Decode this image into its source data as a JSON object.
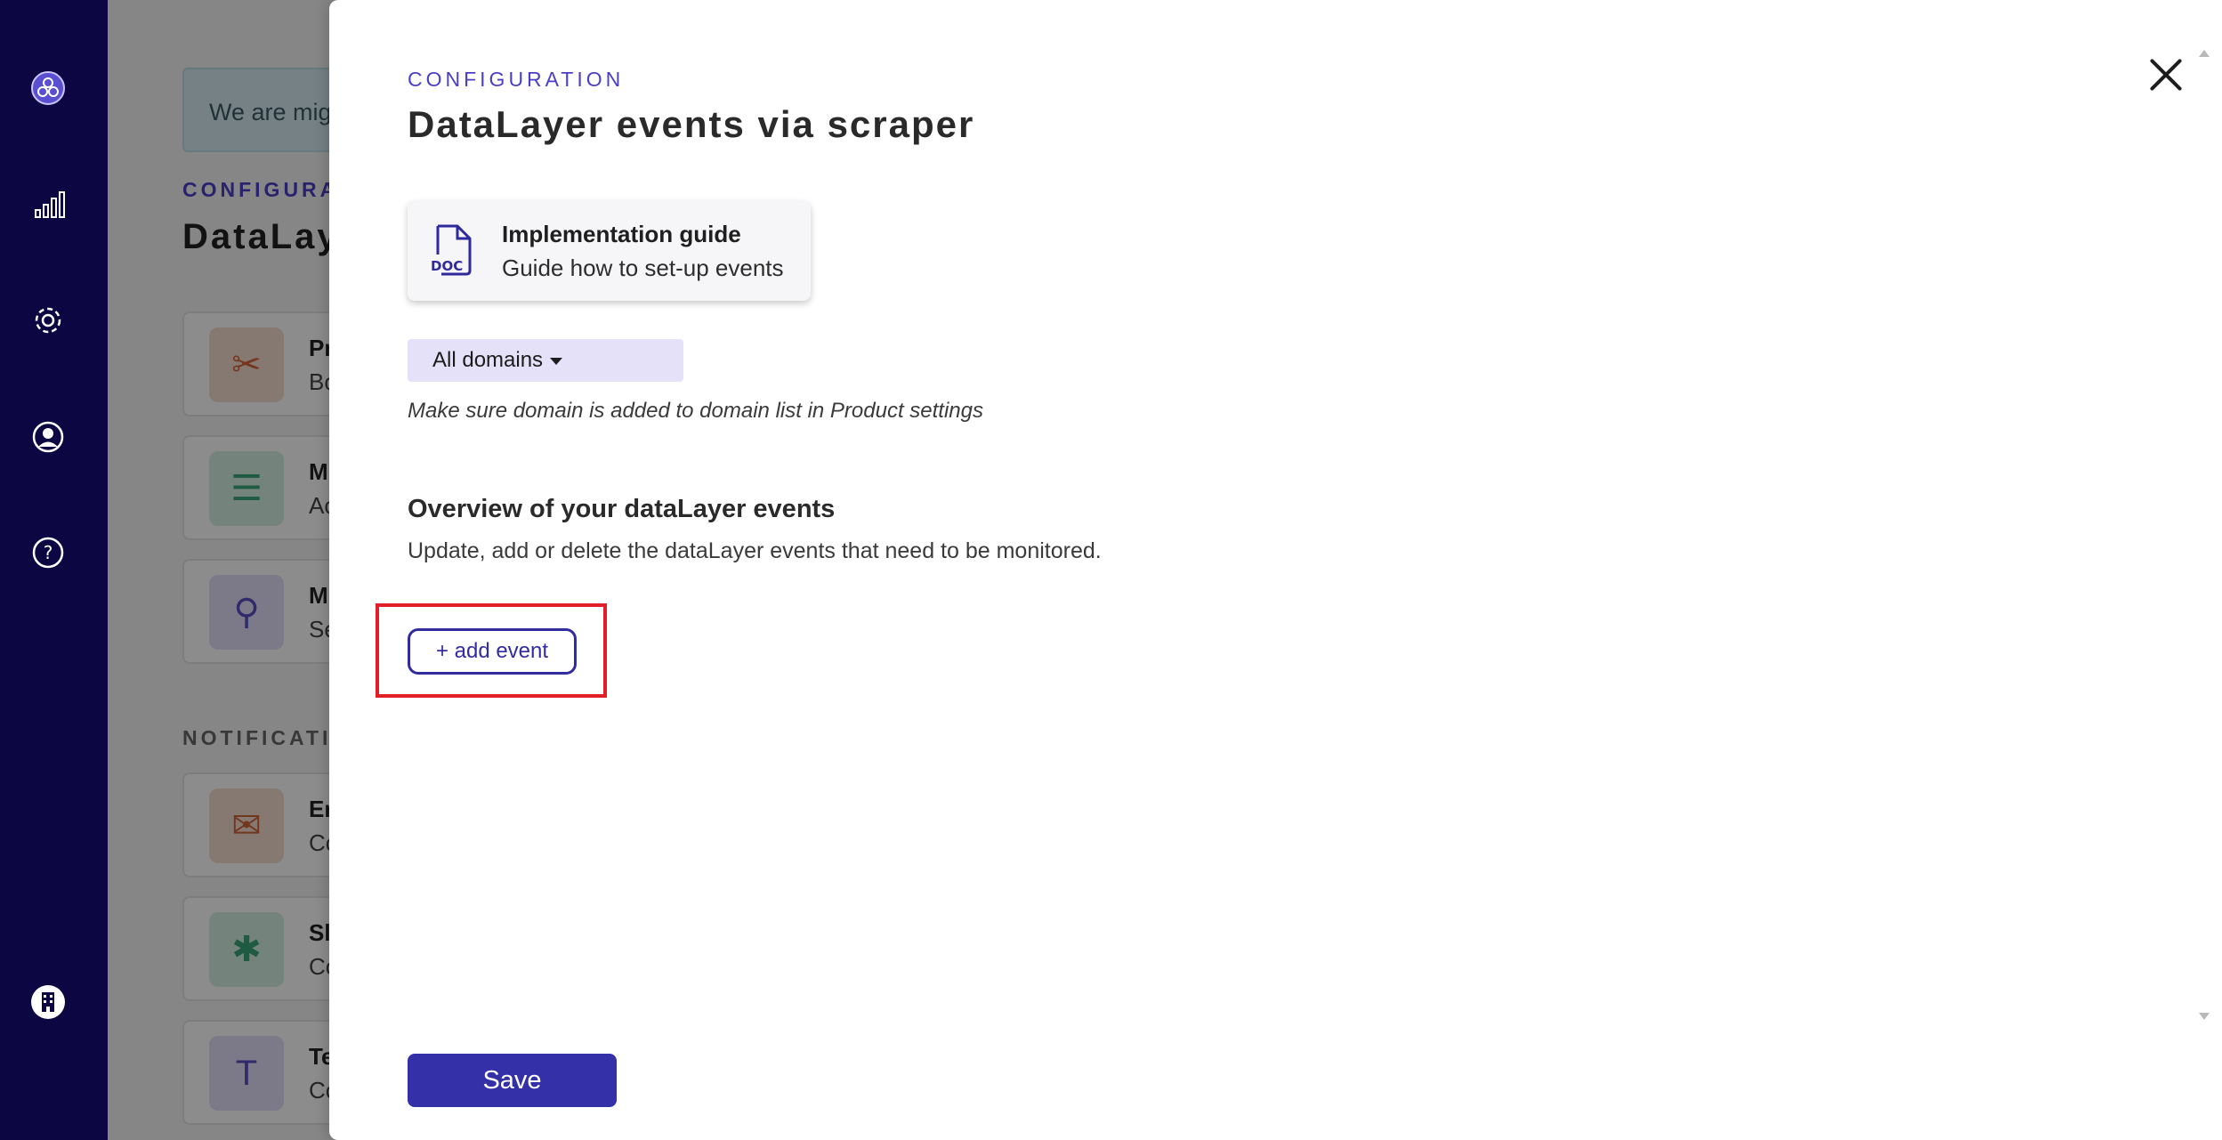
{
  "background": {
    "banner_text": "We are mig",
    "overline": "CONFIGURAT",
    "title": "DataLay",
    "cards": [
      {
        "title": "Pr",
        "subtitle": "Bo",
        "icon": "tools-icon",
        "color": "#e8a07a"
      },
      {
        "title": "M",
        "subtitle": "Ac",
        "icon": "list-icon",
        "color": "#8fd0b5"
      },
      {
        "title": "M",
        "subtitle": "Se",
        "icon": "binoculars-icon",
        "color": "#9a90e0"
      }
    ],
    "notifications_label": "NOTIFICATION",
    "notification_cards": [
      {
        "title": "Er",
        "subtitle": "Co",
        "icon": "mail-icon",
        "color": "#e8a07a"
      },
      {
        "title": "Sl",
        "subtitle": "Co",
        "icon": "slack-icon",
        "color": "#8fd0b5"
      },
      {
        "title": "Te",
        "subtitle": "Co",
        "icon": "teams-icon",
        "color": "#9a90e0"
      }
    ]
  },
  "nav": {
    "items": [
      "logo-icon",
      "chart-icon",
      "gear-icon",
      "user-icon",
      "help-icon",
      "building-icon"
    ]
  },
  "drawer": {
    "overline": "CONFIGURATION",
    "title": "DataLayer events via scraper",
    "guide": {
      "title": "Implementation guide",
      "subtitle": "Guide how to set-up events",
      "icon_label": "DOC"
    },
    "domain_select": {
      "value": "All domains"
    },
    "hint": "Make sure domain is added to domain list in Product settings",
    "overview": {
      "title": "Overview of your dataLayer events",
      "description": "Update, add or delete the dataLayer events that need to be monitored."
    },
    "add_event_label": "+ add event",
    "save_label": "Save"
  },
  "colors": {
    "nav_bg": "#0c0742",
    "accent": "#3430a8",
    "overline": "#4b3fc7",
    "select_bg": "#e4e1f8",
    "highlight": "#e21f26"
  }
}
